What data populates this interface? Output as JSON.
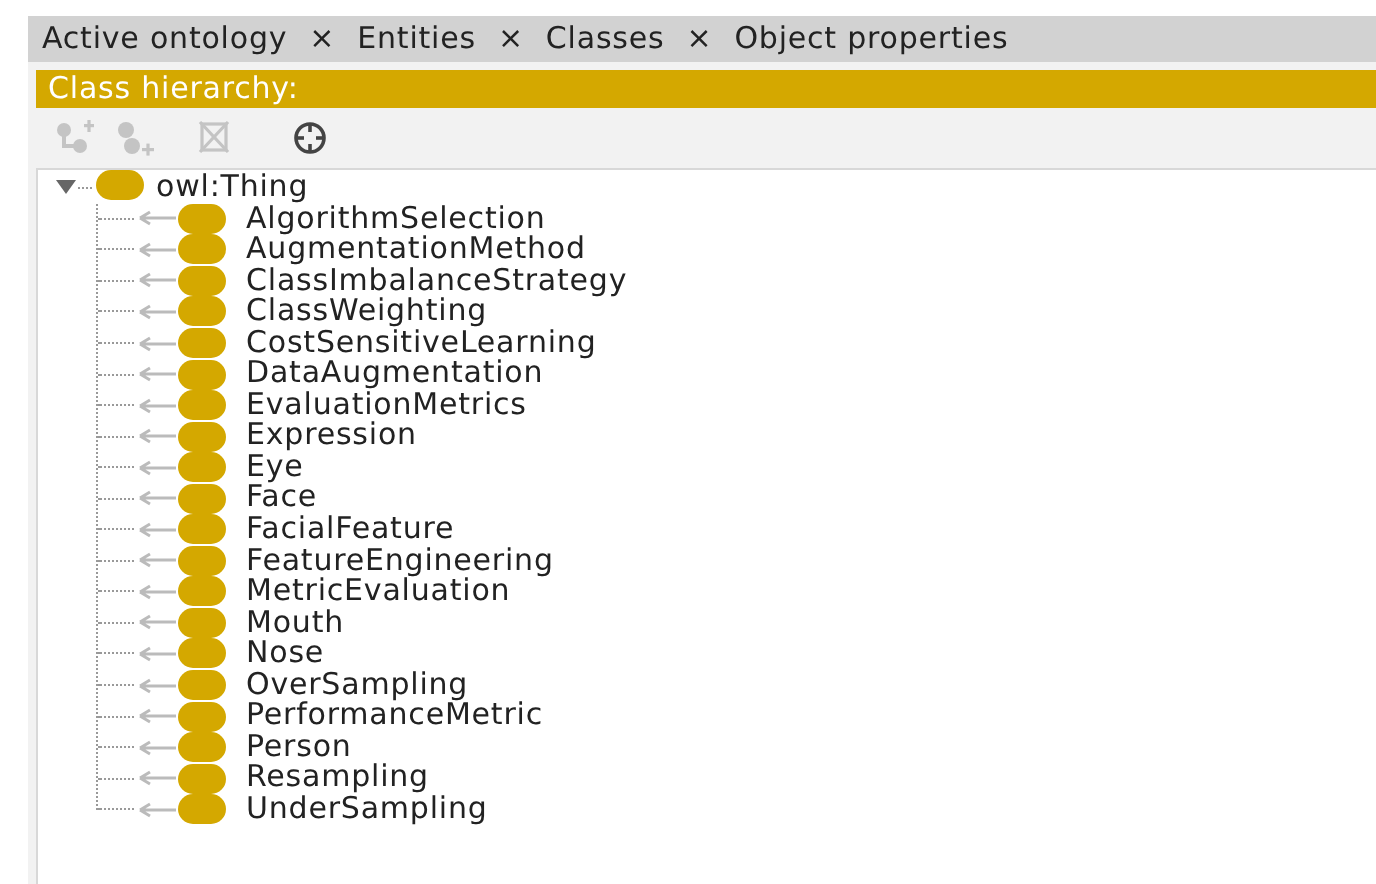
{
  "tabs": [
    {
      "label": "Active ontology",
      "close": "×"
    },
    {
      "label": "Entities",
      "close": "×"
    },
    {
      "label": "Classes",
      "close": "×"
    },
    {
      "label": "Object properties"
    }
  ],
  "panel": {
    "title": "Class hierarchy:"
  },
  "toolbar": [
    {
      "kind": "add-subclass",
      "disabled": true
    },
    {
      "kind": "add-sibling",
      "disabled": true
    },
    {
      "kind": "delete",
      "disabled": true
    },
    {
      "kind": "find",
      "disabled": false
    }
  ],
  "tree": {
    "label": "owl:Thing",
    "expanded": true,
    "children": [
      {
        "label": "AlgorithmSelection"
      },
      {
        "label": "AugmentationMethod"
      },
      {
        "label": "ClassImbalanceStrategy"
      },
      {
        "label": "ClassWeighting"
      },
      {
        "label": "CostSensitiveLearning"
      },
      {
        "label": "DataAugmentation"
      },
      {
        "label": "EvaluationMetrics"
      },
      {
        "label": "Expression"
      },
      {
        "label": "Eye"
      },
      {
        "label": "Face"
      },
      {
        "label": "FacialFeature"
      },
      {
        "label": "FeatureEngineering"
      },
      {
        "label": "MetricEvaluation"
      },
      {
        "label": "Mouth"
      },
      {
        "label": "Nose"
      },
      {
        "label": "OverSampling"
      },
      {
        "label": "PerformanceMetric"
      },
      {
        "label": "Person"
      },
      {
        "label": "Resampling"
      },
      {
        "label": "UnderSampling"
      }
    ]
  }
}
